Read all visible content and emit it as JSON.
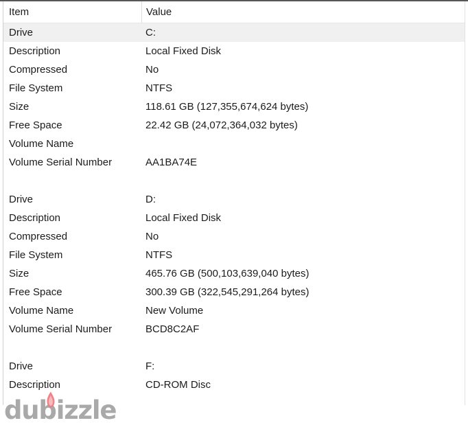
{
  "window": {
    "view_type": "drive-details-list"
  },
  "table": {
    "columns": [
      {
        "key": "item",
        "label": "Item"
      },
      {
        "key": "value",
        "label": "Value"
      }
    ],
    "rows": [
      {
        "item": "Drive",
        "value": "C:",
        "selected": true,
        "blank": false
      },
      {
        "item": "Description",
        "value": "Local Fixed Disk",
        "selected": false,
        "blank": false
      },
      {
        "item": "Compressed",
        "value": "No",
        "selected": false,
        "blank": false
      },
      {
        "item": "File System",
        "value": "NTFS",
        "selected": false,
        "blank": false
      },
      {
        "item": "Size",
        "value": "118.61 GB (127,355,674,624 bytes)",
        "selected": false,
        "blank": false
      },
      {
        "item": "Free Space",
        "value": "22.42 GB (24,072,364,032 bytes)",
        "selected": false,
        "blank": false
      },
      {
        "item": "Volume Name",
        "value": "",
        "selected": false,
        "blank": false
      },
      {
        "item": "Volume Serial Number",
        "value": "AA1BA74E",
        "selected": false,
        "blank": false
      },
      {
        "item": "",
        "value": "",
        "selected": false,
        "blank": true
      },
      {
        "item": "Drive",
        "value": "D:",
        "selected": false,
        "blank": false
      },
      {
        "item": "Description",
        "value": "Local Fixed Disk",
        "selected": false,
        "blank": false
      },
      {
        "item": "Compressed",
        "value": "No",
        "selected": false,
        "blank": false
      },
      {
        "item": "File System",
        "value": "NTFS",
        "selected": false,
        "blank": false
      },
      {
        "item": "Size",
        "value": "465.76 GB (500,103,639,040 bytes)",
        "selected": false,
        "blank": false
      },
      {
        "item": "Free Space",
        "value": "300.39 GB (322,545,291,264 bytes)",
        "selected": false,
        "blank": false
      },
      {
        "item": "Volume Name",
        "value": "New Volume",
        "selected": false,
        "blank": false
      },
      {
        "item": "Volume Serial Number",
        "value": "BCD8C2AF",
        "selected": false,
        "blank": false
      },
      {
        "item": "",
        "value": "",
        "selected": false,
        "blank": true
      },
      {
        "item": "Drive",
        "value": "F:",
        "selected": false,
        "blank": false
      },
      {
        "item": "Description",
        "value": "CD-ROM Disc",
        "selected": false,
        "blank": false
      }
    ]
  },
  "watermark": {
    "text": "dubizzle",
    "flame_color": "#ef7b82",
    "text_color": "#9b9b9b"
  },
  "colors": {
    "selection": "#f0f0f0",
    "text": "#1b1b1b",
    "header_rule": "#575757",
    "border": "#d0d0d0"
  }
}
